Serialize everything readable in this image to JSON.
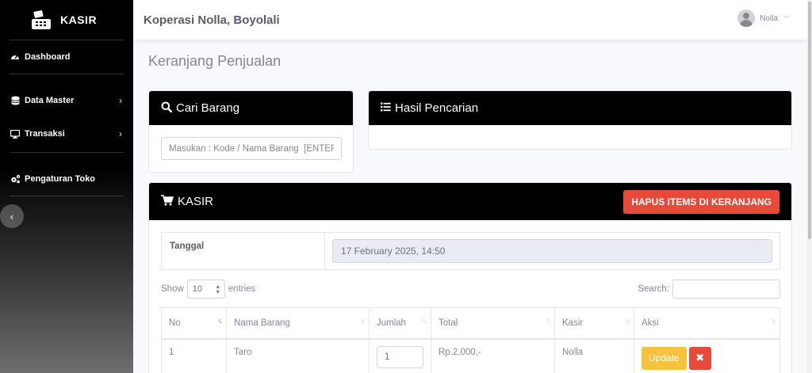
{
  "sidebar": {
    "brand": "KASIR",
    "items": [
      {
        "label": "Dashboard",
        "icon": "dashboard-icon"
      },
      {
        "label": "Data Master",
        "icon": "database-icon"
      },
      {
        "label": "Transaksi",
        "icon": "desktop-icon"
      },
      {
        "label": "Pengaturan Toko",
        "icon": "cogs-icon"
      }
    ],
    "toggle_icon": "chevron-left-icon"
  },
  "topbar": {
    "store_name": "Koperasi Nolla, Boyolali",
    "user_name": "Nolla",
    "user_icon": "chevron-down-icon"
  },
  "page": {
    "title": "Keranjang Penjualan"
  },
  "search_card": {
    "title": "Cari Barang",
    "placeholder": "Masukan : Kode / Nama Barang  [ENTER]"
  },
  "result_card": {
    "title": "Hasil Pencarian"
  },
  "kasir_card": {
    "title": "KASIR",
    "clear_button": "HAPUS ITEMS DI KERANJANG",
    "date_label": "Tanggal",
    "date_value": "17 February 2025, 14:50",
    "show_label": "Show",
    "entries_value": "10",
    "entries_label": "entries",
    "search_label": "Search:",
    "columns": [
      "No",
      "Nama Barang",
      "Jumlah",
      "Total",
      "Kasir",
      "Aksi"
    ],
    "rows": [
      {
        "no": "1",
        "nama": "Taro",
        "jumlah": "1",
        "total": "Rp.2,000,-",
        "kasir": "Nolla",
        "update": "Update",
        "delete": "✖"
      }
    ]
  },
  "colors": {
    "sidebar": "#000000",
    "danger": "#e74a3b",
    "warning": "#f6c23e",
    "background": "#f8f9fc"
  }
}
